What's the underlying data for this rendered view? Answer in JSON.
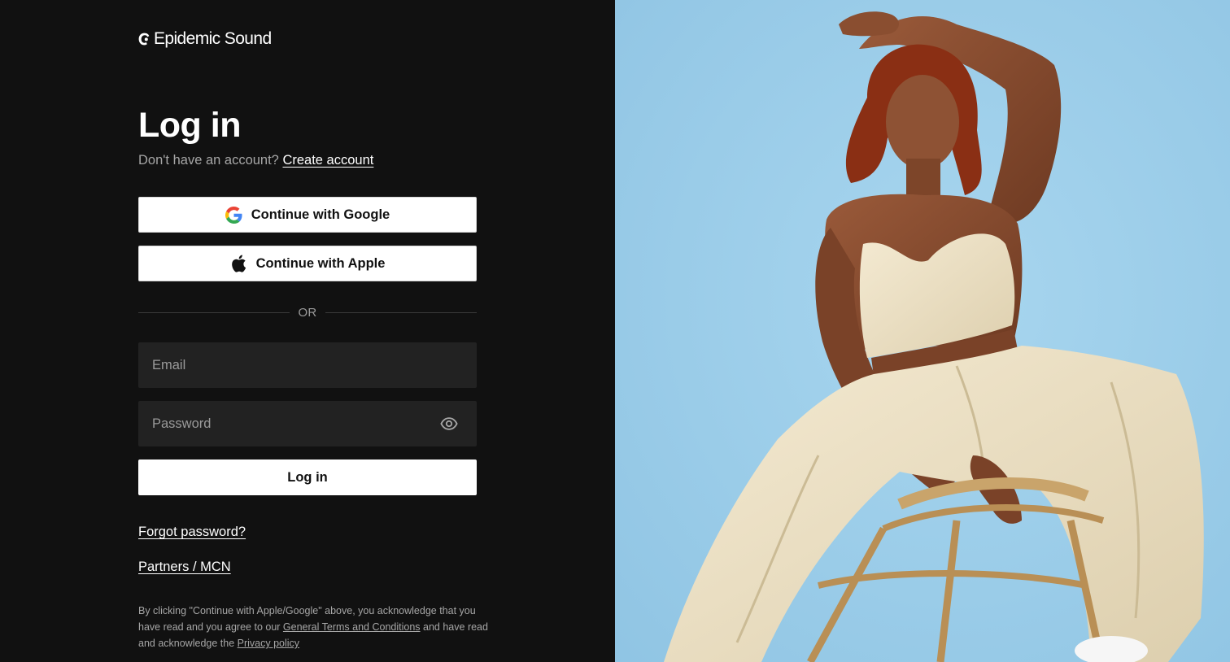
{
  "brand": {
    "name": "Epidemic Sound"
  },
  "login": {
    "title": "Log in",
    "signup_prompt": "Don't have an account?",
    "signup_link": "Create account",
    "google_label": "Continue with Google",
    "apple_label": "Continue with Apple",
    "divider": "OR",
    "email_placeholder": "Email",
    "password_placeholder": "Password",
    "submit_label": "Log in",
    "forgot_link": "Forgot password?",
    "partners_link": "Partners / MCN"
  },
  "legal": {
    "part1": "By clicking \"Continue with Apple/Google\" above, you acknowledge that you have read and you agree to our",
    "terms_link": "General Terms and Conditions",
    "part2": "and have read and acknowledge the",
    "privacy_link": "Privacy policy"
  },
  "icons": {
    "google": "google-icon",
    "apple": "apple-icon",
    "eye": "eye-icon",
    "logo": "epidemic-sound-logo-icon"
  },
  "colors": {
    "background": "#111111",
    "input_background": "#222222",
    "button_background": "#ffffff",
    "muted_text": "#a6a6a6",
    "hero_background": "#9fcfe9"
  }
}
